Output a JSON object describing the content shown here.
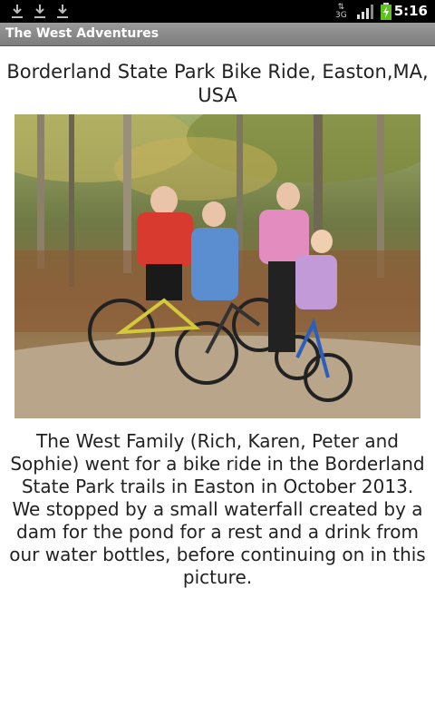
{
  "status_bar": {
    "time": "5:16",
    "network_label": "3G",
    "icons": [
      "download-icon",
      "download-icon",
      "download-icon",
      "network-3g-icon",
      "signal-icon",
      "battery-charging-icon"
    ]
  },
  "app": {
    "title": "The West Adventures"
  },
  "post": {
    "heading": "Borderland State Park Bike Ride, Easton,MA, USA",
    "photo": {
      "subject": "family-with-bikes-photo"
    },
    "caption": "The West Family (Rich, Karen, Peter and Sophie) went for a bike ride in the Borderland State Park trails in Easton in October 2013. We stopped by a small waterfall created by a dam for the pond for a rest and a drink from our water bottles, before continuing on in this picture."
  },
  "colors": {
    "status_bar": "#000000",
    "title_bar": "#8a8a8a",
    "battery": "#5cc21c"
  }
}
